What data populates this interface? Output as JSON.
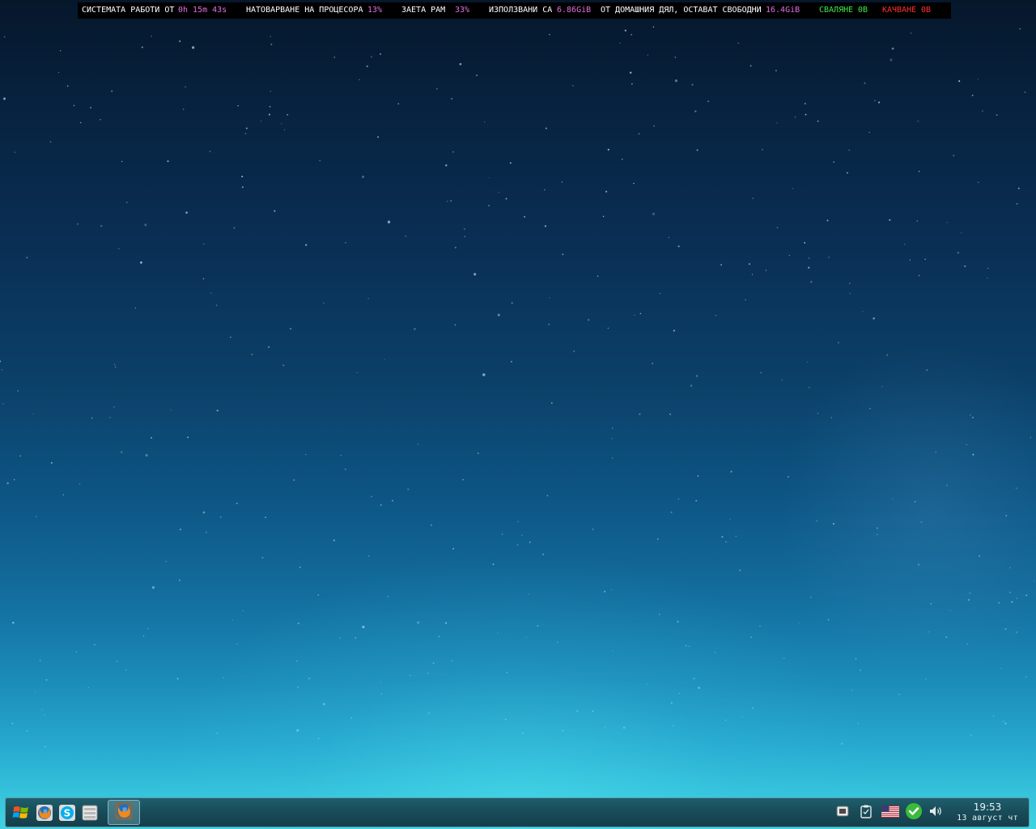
{
  "status_bar": {
    "uptime_label": "СИСТЕМАТА РАБОТИ ОТ",
    "uptime_value": "0h 15m 43s",
    "cpu_label": "НАТОВАРВАНЕ НА ПРОЦЕСОРА",
    "cpu_value": "13%",
    "ram_label": "ЗАЕТА РАМ",
    "ram_value": "33%",
    "disk_used_label": "ИЗПОЛЗВАНИ СА",
    "disk_used_value": "6.86GiB",
    "disk_free_label": "ОТ ДОМАШНИЯ ДЯЛ, ОСТАВАТ СВОБОДНИ",
    "disk_free_value": "16.4GiB",
    "download_label": "СВАЛЯНЕ",
    "download_value": "0B",
    "upload_label": "КАЧВАНЕ",
    "upload_value": "0B",
    "colors": {
      "value": "#e070e0",
      "download": "#3ee84a",
      "upload": "#ff3030"
    }
  },
  "taskbar": {
    "launchers": [
      {
        "icon": "start-menu-icon"
      },
      {
        "icon": "firefox-icon"
      },
      {
        "icon": "skype-icon"
      },
      {
        "icon": "file-manager-icon"
      }
    ],
    "tasks": [
      {
        "icon": "firefox-icon",
        "active": true
      }
    ],
    "tray": [
      {
        "icon": "device-notifier-icon"
      },
      {
        "icon": "clipboard-icon"
      },
      {
        "icon": "keyboard-layout-us-flag-icon"
      },
      {
        "icon": "updates-ok-icon"
      },
      {
        "icon": "volume-icon"
      }
    ],
    "clock": {
      "time": "19:53",
      "date": "13 август чт"
    }
  }
}
